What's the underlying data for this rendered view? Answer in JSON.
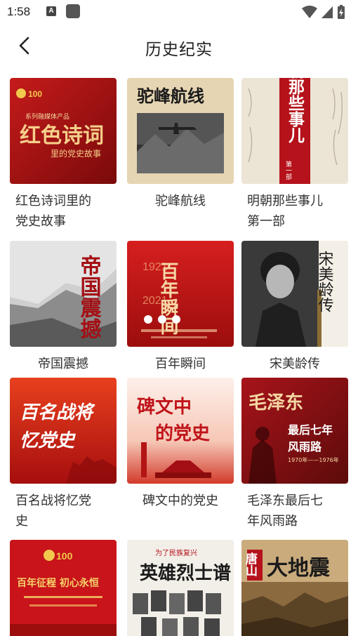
{
  "status_bar": {
    "time": "1:58",
    "notif_icon": "A"
  },
  "header": {
    "title": "历史纪实"
  },
  "items": [
    {
      "title": "红色诗词里的党史故事",
      "thumb_text": [
        "系列融媒体产品",
        "红色诗词",
        "里的党史故事"
      ]
    },
    {
      "title": "驼峰航线",
      "thumb_text": [
        "驼峰航线"
      ]
    },
    {
      "title": "明朝那些事儿第一部",
      "thumb_text": [
        "明朝那些事儿",
        "第一部"
      ]
    },
    {
      "title": "帝国震撼",
      "thumb_text": [
        "帝国震撼"
      ]
    },
    {
      "title": "百年瞬间",
      "thumb_text": [
        "百年瞬间",
        "1921",
        "2021"
      ]
    },
    {
      "title": "宋美龄传",
      "thumb_text": [
        "宋美龄传"
      ]
    },
    {
      "title": "百名战将忆党史",
      "thumb_text": [
        "百名战将",
        "忆党史"
      ]
    },
    {
      "title": "碑文中的党史",
      "thumb_text": [
        "碑文中",
        "的党史"
      ]
    },
    {
      "title": "毛泽东最后七年风雨路",
      "thumb_text": [
        "毛泽东",
        "最后七年",
        "风雨路",
        "1970年——1976年"
      ]
    },
    {
      "title": "",
      "thumb_text": [
        "百年征程 初心永恒"
      ]
    },
    {
      "title": "",
      "thumb_text": [
        "为了民族复兴",
        "英雄烈士谱"
      ]
    },
    {
      "title": "",
      "thumb_text": [
        "唐山",
        "大地震"
      ]
    }
  ],
  "label_lines": [
    [
      "红色诗词里的",
      "党史故事"
    ],
    [
      "驼峰航线"
    ],
    [
      "明朝那些事儿",
      "第一部"
    ],
    [
      "帝国震撼"
    ],
    [
      "百年瞬间"
    ],
    [
      "宋美龄传"
    ],
    [
      "百名战将忆党",
      "史"
    ],
    [
      "碑文中的党史"
    ],
    [
      "毛泽东最后七",
      "年风雨路"
    ]
  ],
  "colors": {
    "accent_red": "#b5121b",
    "text": "#333333"
  },
  "icons": {
    "back": "chevron-left-icon",
    "wifi": "wifi-icon",
    "signal": "signal-icon",
    "battery": "battery-charging-icon"
  }
}
